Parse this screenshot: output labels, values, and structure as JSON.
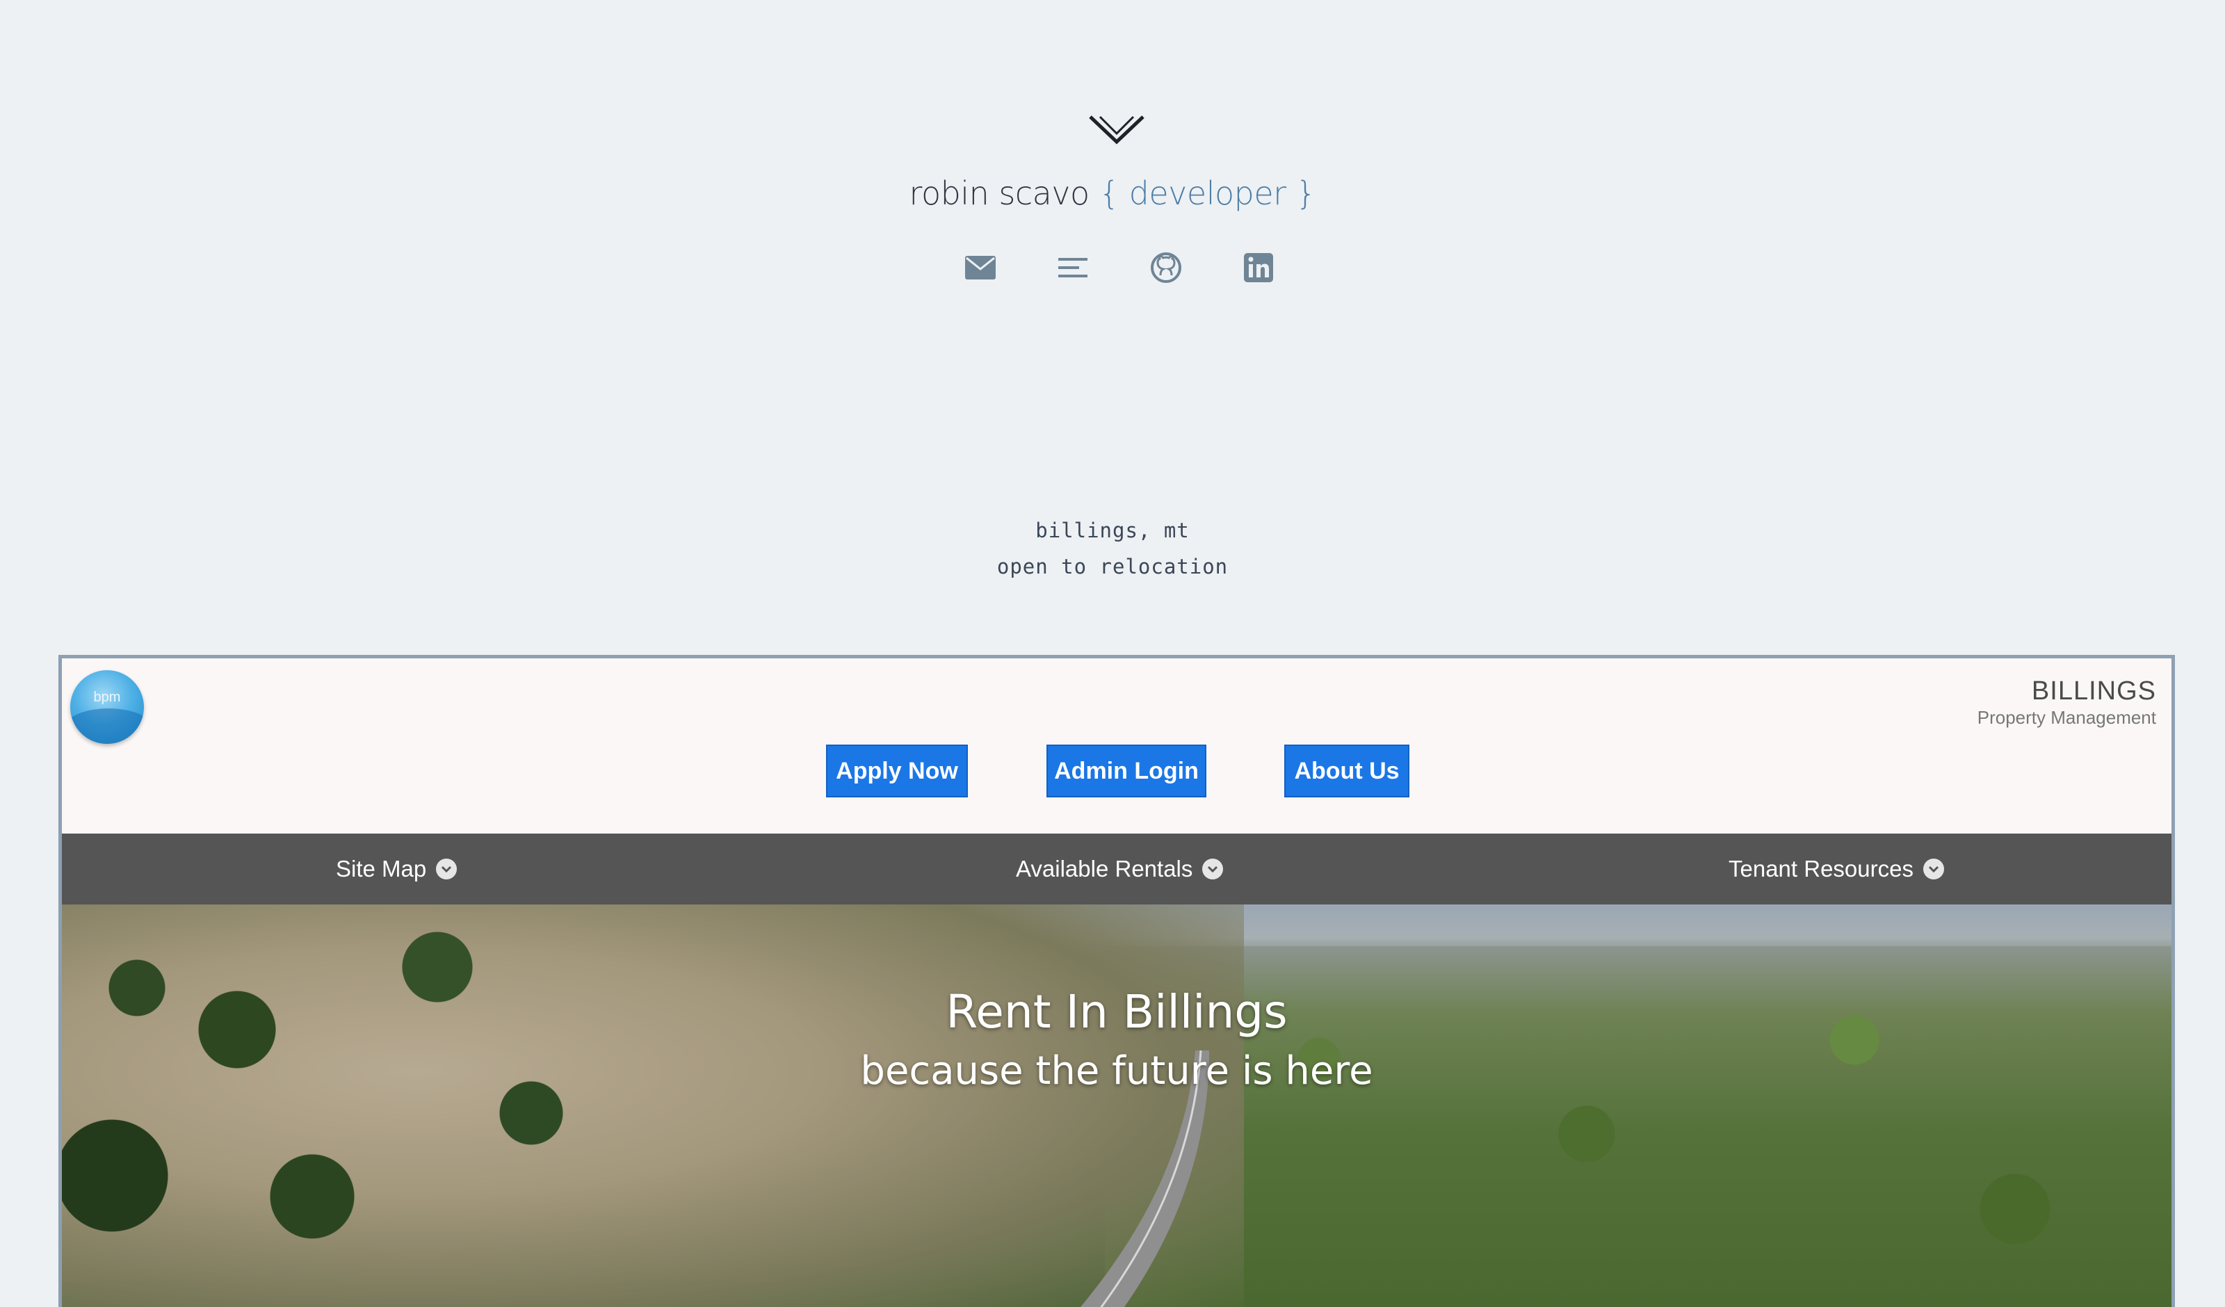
{
  "portfolio": {
    "name": "robin scavo",
    "role_text": "{ developer }",
    "social": [
      {
        "icon": "envelope-icon",
        "label": "email"
      },
      {
        "icon": "menu-lines-icon",
        "label": "resume"
      },
      {
        "icon": "github-icon",
        "label": "github"
      },
      {
        "icon": "linkedin-icon",
        "label": "linkedin"
      }
    ],
    "location_line1": "billings, mt",
    "location_line2": "open to relocation"
  },
  "preview_site": {
    "logo_text": "bpm",
    "brand_name": "BILLINGS",
    "brand_sub": "Property Management",
    "buttons": {
      "apply": "Apply Now",
      "admin": "Admin Login",
      "about": "About Us"
    },
    "nav": {
      "site_map": "Site Map",
      "rentals": "Available Rentals",
      "tenant": "Tenant Resources"
    },
    "hero_title": "Rent In Billings",
    "hero_subtitle": "because the future is here"
  },
  "colors": {
    "background": "#edf1f4",
    "accent": "#4f7ea6",
    "button_blue": "#1b77e6",
    "nav_gray": "#555555"
  }
}
